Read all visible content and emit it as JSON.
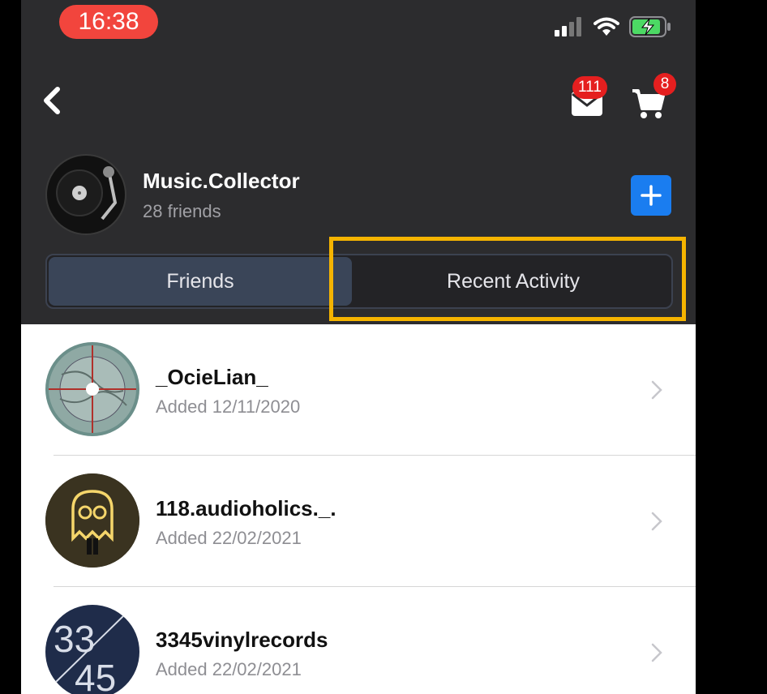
{
  "status_bar": {
    "time": "16:38"
  },
  "header": {
    "mail_badge": "111",
    "cart_badge": "8"
  },
  "profile": {
    "name": "Music.Collector",
    "friends_count": "28 friends"
  },
  "tabs": [
    {
      "label": "Friends",
      "selected": true
    },
    {
      "label": "Recent Activity",
      "selected": false
    }
  ],
  "friends": [
    {
      "name": "_OcieLian_",
      "added": "Added 12/11/2020"
    },
    {
      "name": "118.audioholics._.",
      "added": "Added 22/02/2021"
    },
    {
      "name": "3345vinylrecords",
      "added": "Added 22/02/2021"
    }
  ],
  "colors": {
    "header_bg": "#2c2c2e",
    "accent_blue": "#1a7df0",
    "badge_red": "#e51f1f",
    "highlight": "#f5b400"
  }
}
